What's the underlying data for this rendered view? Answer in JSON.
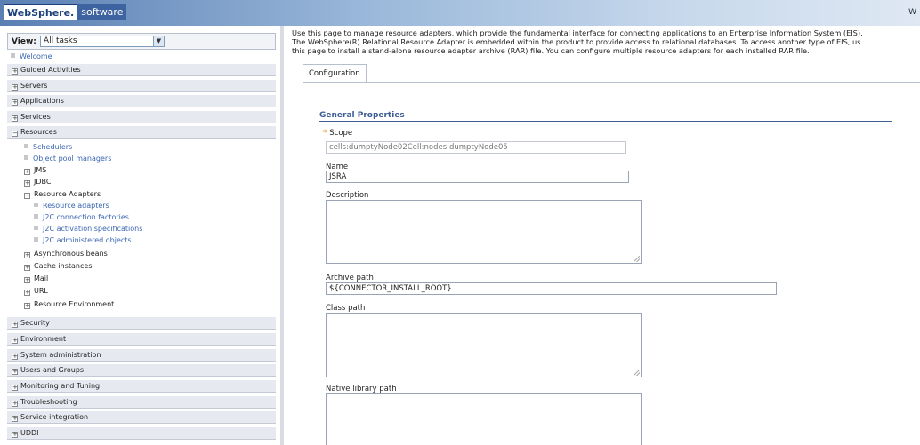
{
  "banner": {
    "brand_main": "WebSphere.",
    "brand_sub": "software",
    "right_text": "W"
  },
  "nav": {
    "view_label": "View:",
    "view_value": "All tasks",
    "welcome": "Welcome",
    "top_items": [
      "Guided Activities",
      "Servers",
      "Applications",
      "Services",
      "Resources"
    ],
    "resources_children": {
      "schedulers": "Schedulers",
      "object_pool_managers": "Object pool managers",
      "jms": "JMS",
      "jdbc": "JDBC",
      "resource_adapters": "Resource Adapters",
      "ra_children": [
        "Resource adapters",
        "J2C connection factories",
        "J2C activation specifications",
        "J2C administered objects"
      ],
      "async_beans": "Asynchronous beans",
      "cache_instances": "Cache instances",
      "mail": "Mail",
      "url": "URL",
      "resource_env": "Resource Environment"
    },
    "bottom_items": [
      "Security",
      "Environment",
      "System administration",
      "Users and Groups",
      "Monitoring and Tuning",
      "Troubleshooting",
      "Service integration",
      "UDDI"
    ],
    "expand_symbol": "+",
    "collapse_symbol": "−"
  },
  "main": {
    "description": [
      "Use this page to manage resource adapters, which provide the fundamental interface for connecting applications to an Enterprise Information System (EIS).",
      "The WebSphere(R) Relational Resource Adapter is embedded within the product to provide access to relational databases. To access another type of EIS, us",
      "this page to install a stand-alone resource adapter archive (RAR) file. You can configure multiple resource adapters for each installed RAR file."
    ],
    "tab_label": "Configuration",
    "section_title": "General Properties",
    "fields": {
      "scope_label": "Scope",
      "scope_value": "cells:dumptyNode02Cell:nodes:dumptyNode05",
      "name_label": "Name",
      "name_value": "JSRA",
      "description_label": "Description",
      "archive_path_label": "Archive path",
      "archive_path_value": "${CONNECTOR_INSTALL_ROOT}",
      "class_path_label": "Class path",
      "native_library_path_label": "Native library path"
    },
    "required_marker": "*"
  }
}
